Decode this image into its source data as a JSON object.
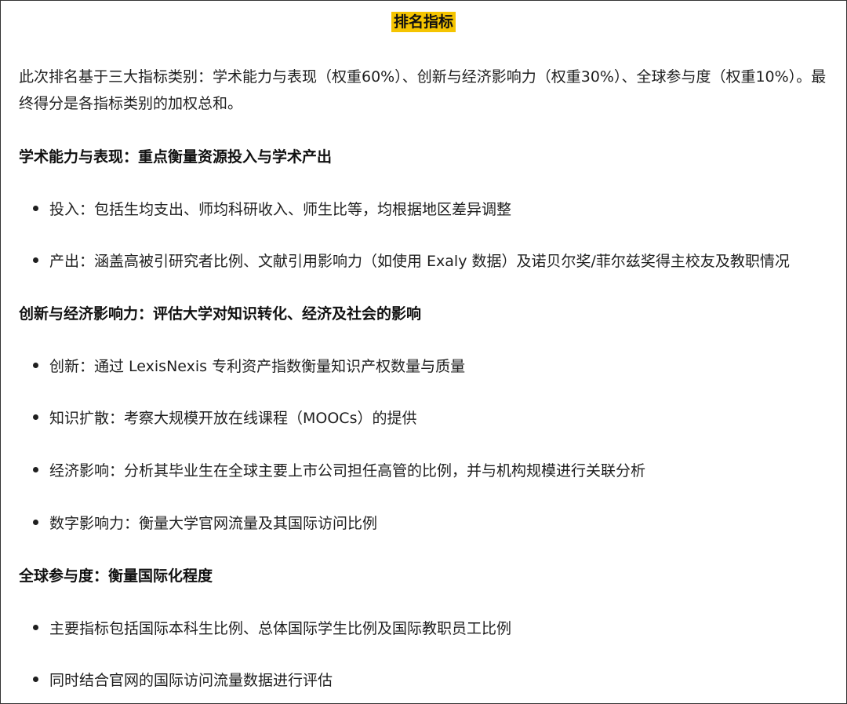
{
  "title": "排名指标",
  "intro": "此次排名基于三大指标类别：学术能力与表现（权重60%）、创新与经济影响力（权重30%）、全球参与度（权重10%）。最终得分是各指标类别的加权总和。",
  "sections": [
    {
      "heading": "学术能力与表现：重点衡量资源投入与学术产出",
      "items": [
        "投入：包括生均支出、师均科研收入、师生比等，均根据地区差异调整",
        "产出：涵盖高被引研究者比例、文献引用影响力（如使用 Exaly 数据）及诺贝尔奖/菲尔兹奖得主校友及教职情况"
      ]
    },
    {
      "heading": "创新与经济影响力：评估大学对知识转化、经济及社会的影响",
      "items": [
        "创新：通过 LexisNexis 专利资产指数衡量知识产权数量与质量",
        "知识扩散：考察大规模开放在线课程（MOOCs）的提供",
        "经济影响：分析其毕业生在全球主要上市公司担任高管的比例，并与机构规模进行关联分析",
        "数字影响力：衡量大学官网流量及其国际访问比例"
      ]
    },
    {
      "heading": "全球参与度：衡量国际化程度",
      "items": [
        "主要指标包括国际本科生比例、总体国际学生比例及国际教职员工比例",
        "同时结合官网的国际访问流量数据进行评估"
      ]
    }
  ],
  "colors": {
    "title_highlight": "#f5c400",
    "text": "#1f1f1f",
    "border": "#333333"
  }
}
